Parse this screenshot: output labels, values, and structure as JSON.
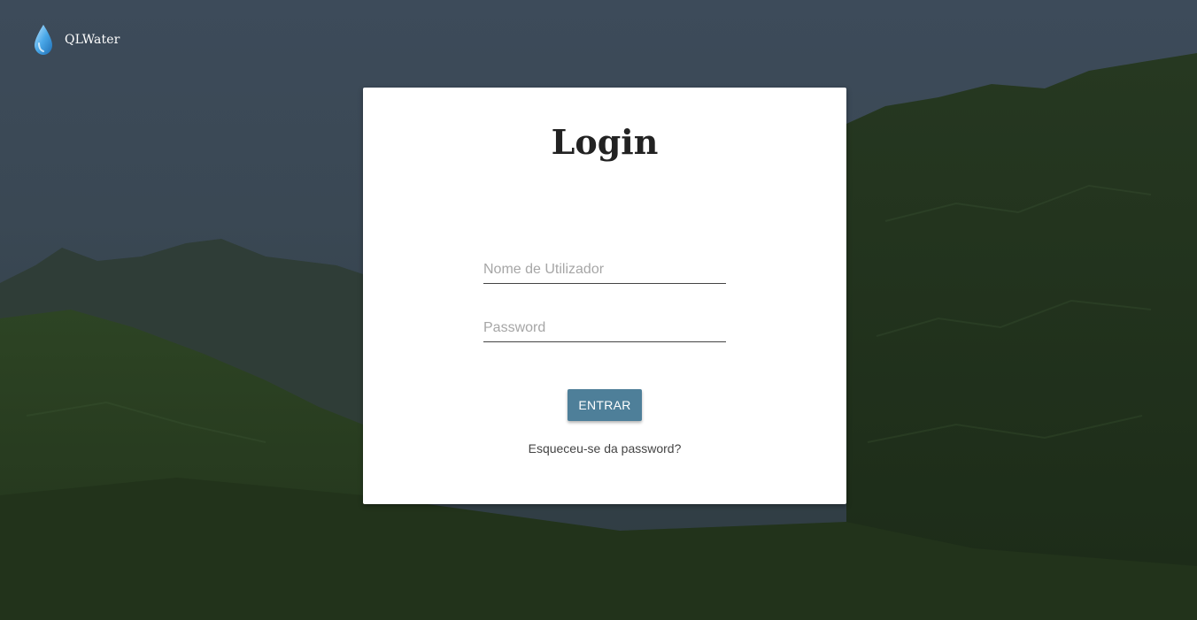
{
  "app": {
    "brand_name": "QLWater",
    "logo_icon": "water-drop-icon",
    "accent_color": "#4e7f99"
  },
  "login": {
    "title": "Login",
    "username_placeholder": "Nome de Utilizador",
    "username_value": "",
    "password_placeholder": "Password",
    "password_value": "",
    "submit_label": "ENTRAR",
    "forgot_link": "Esqueceu-se da password?"
  }
}
